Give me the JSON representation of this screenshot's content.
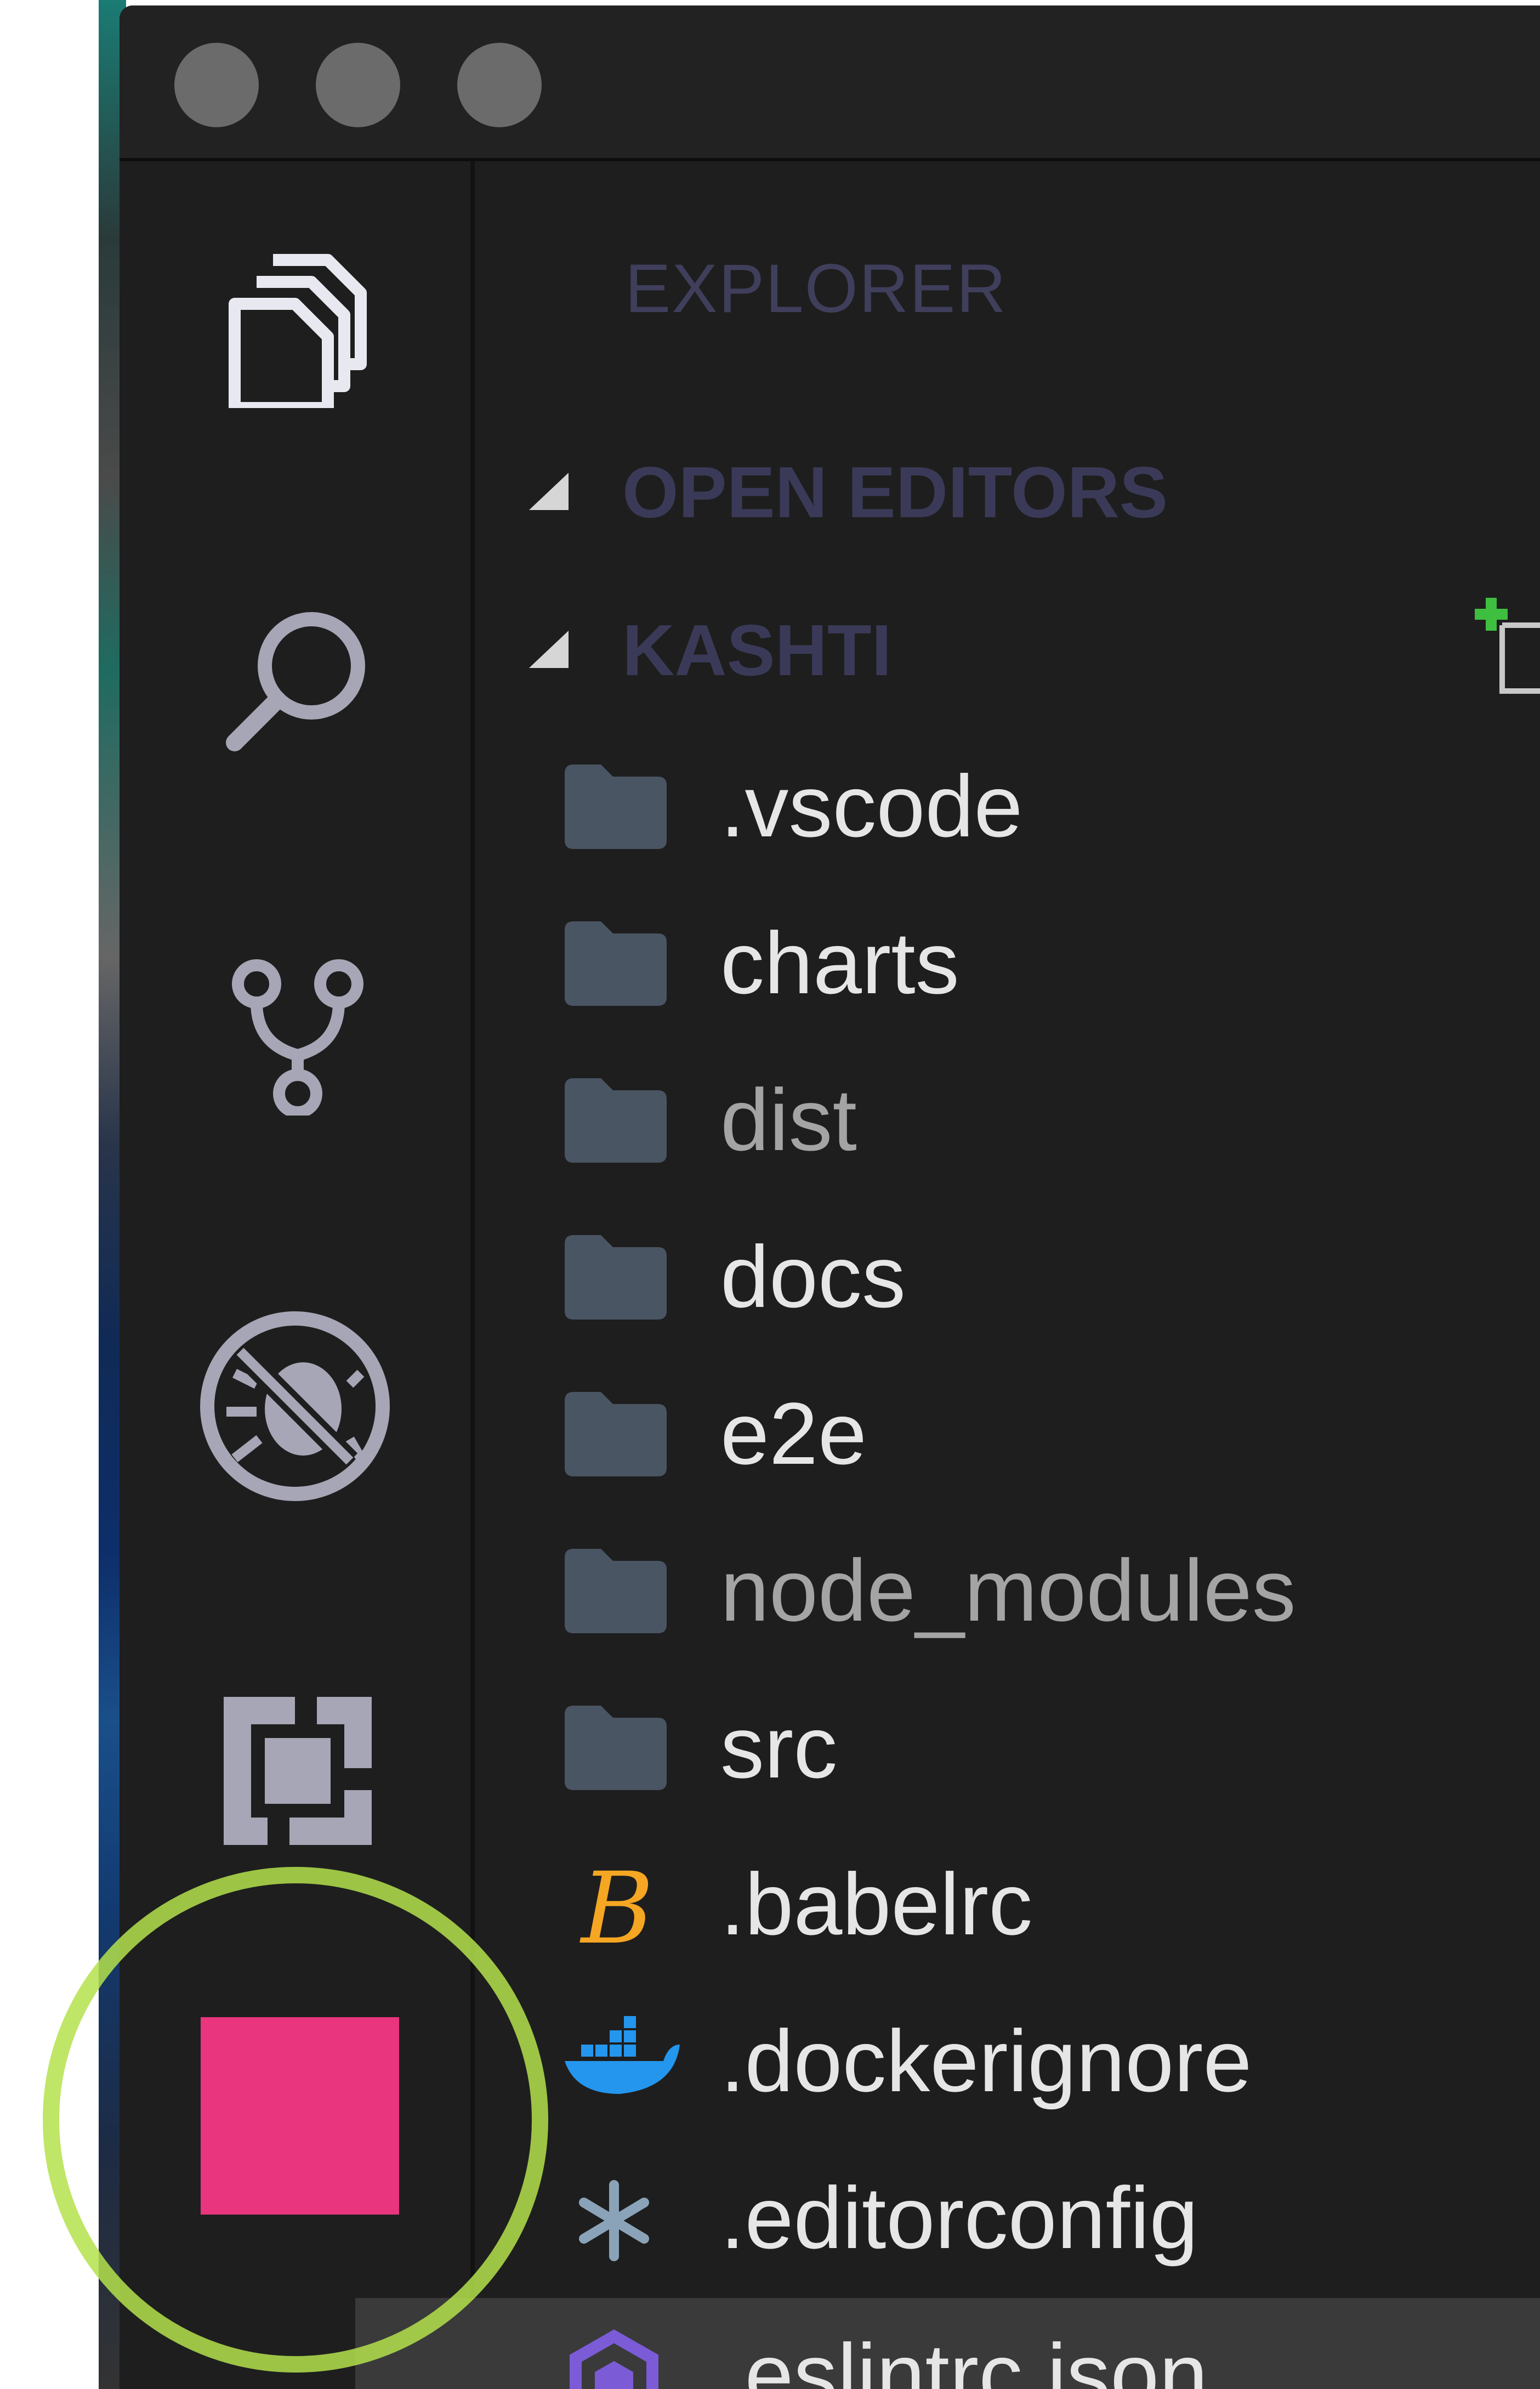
{
  "window": {
    "traffic_lights": [
      "close",
      "minimize",
      "zoom"
    ]
  },
  "activity_bar": {
    "items": [
      {
        "name": "explorer",
        "icon": "files-icon"
      },
      {
        "name": "search",
        "icon": "search-icon"
      },
      {
        "name": "source-control",
        "icon": "source-control-icon"
      },
      {
        "name": "debug",
        "icon": "debug-disabled-icon"
      },
      {
        "name": "extensions",
        "icon": "extensions-icon"
      },
      {
        "name": "custom",
        "icon": "pink-square-icon"
      }
    ]
  },
  "sidebar": {
    "title": "EXPLORER",
    "sections": {
      "open_editors": "OPEN EDITORS",
      "project": "KASHTI"
    },
    "files": [
      {
        "label": ".vscode",
        "type": "folder",
        "dim": false
      },
      {
        "label": "charts",
        "type": "folder",
        "dim": false
      },
      {
        "label": "dist",
        "type": "folder",
        "dim": true
      },
      {
        "label": "docs",
        "type": "folder",
        "dim": false
      },
      {
        "label": "e2e",
        "type": "folder",
        "dim": false
      },
      {
        "label": "node_modules",
        "type": "folder",
        "dim": true
      },
      {
        "label": "src",
        "type": "folder",
        "dim": false
      },
      {
        "label": ".babelrc",
        "type": "babel-file",
        "dim": false
      },
      {
        "label": ".dockerignore",
        "type": "docker-file",
        "dim": false
      },
      {
        "label": ".editorconfig",
        "type": "editorconfig-file",
        "dim": false
      },
      {
        "label": ".eslintrc.json",
        "type": "eslint-file",
        "dim": false
      }
    ]
  },
  "colors": {
    "highlight_ring": "#b4e24c",
    "custom_icon": "#e8357d",
    "babel_icon": "#f5a623",
    "docker_icon": "#2496ed",
    "eslint_icon": "#7b5bd6",
    "folder_icon": "#4a5563"
  }
}
